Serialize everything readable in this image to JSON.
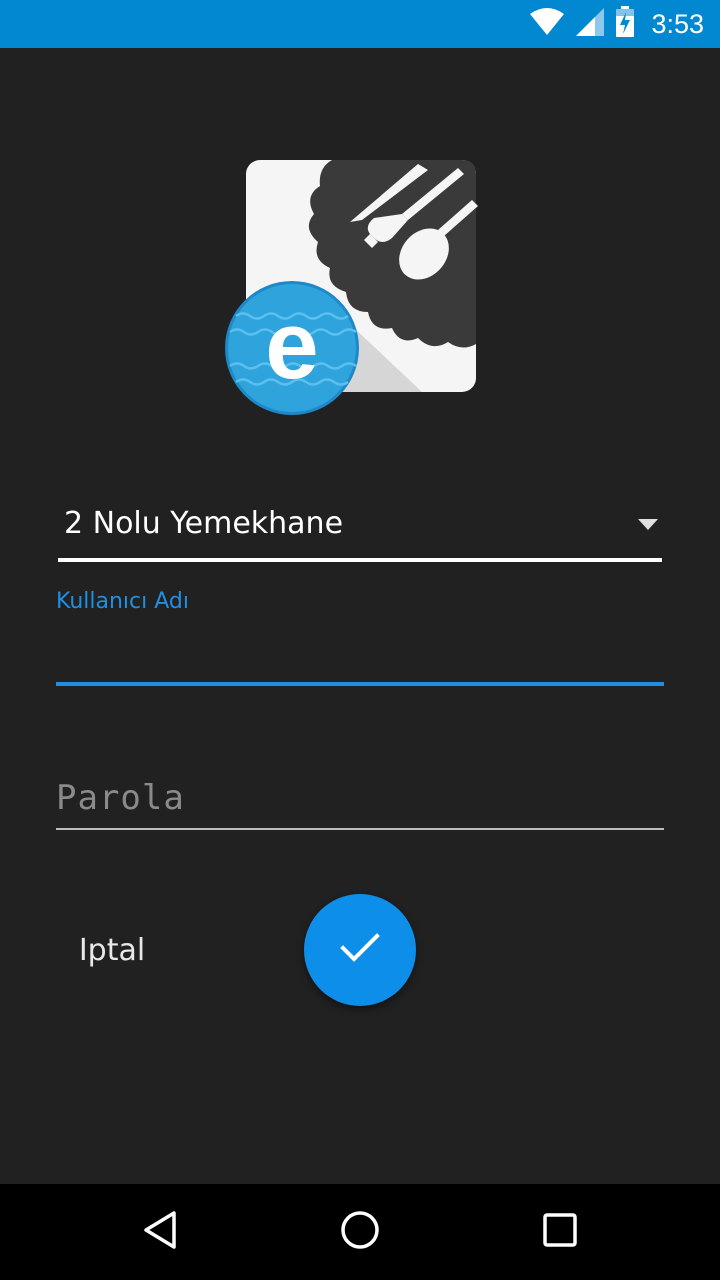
{
  "status_bar": {
    "time": "3:53",
    "icons": [
      "wifi-icon",
      "signal-icon",
      "battery-charging-icon"
    ],
    "background_color": "#0288d1"
  },
  "logo": {
    "letter": "e"
  },
  "dining_hall_select": {
    "selected_value": "2 Nolu Yemekhane"
  },
  "username_field": {
    "label": "Kullanıcı Adı",
    "value": "",
    "accent_color": "#1e8fe2"
  },
  "password_field": {
    "placeholder": "Parola",
    "value": ""
  },
  "actions": {
    "cancel_label": "Iptal",
    "confirm_icon": "check-icon",
    "fab_color": "#0d8ee9"
  },
  "nav_bar": {
    "buttons": [
      "back-icon",
      "home-icon",
      "recents-icon"
    ]
  }
}
